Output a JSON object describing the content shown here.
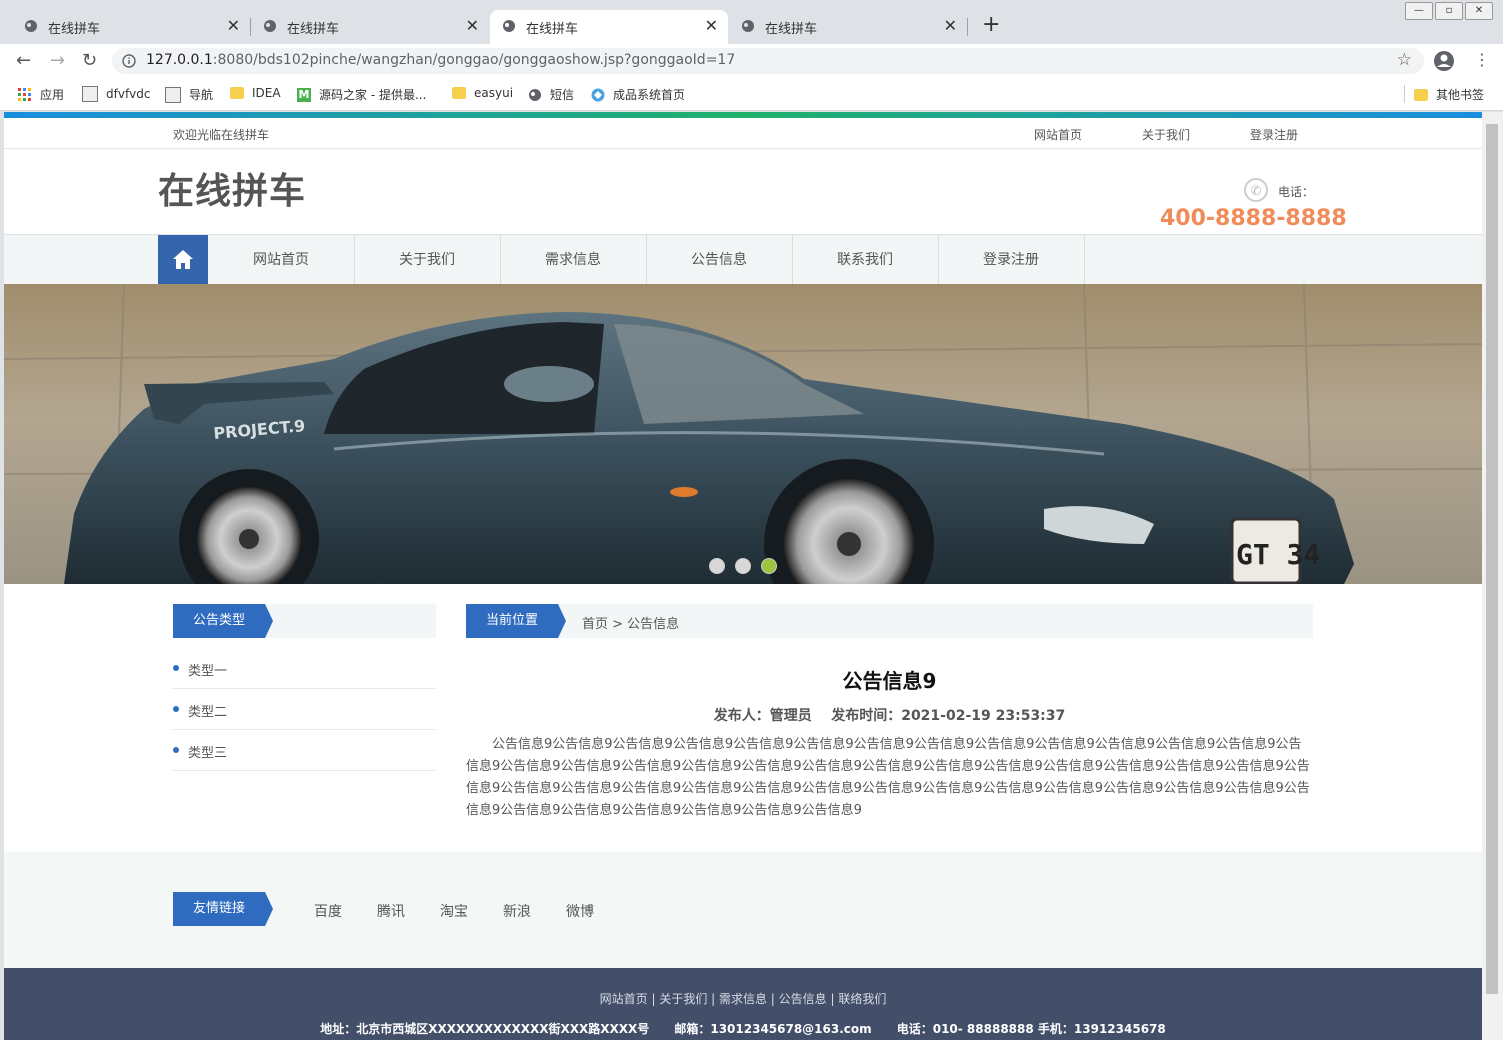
{
  "browser": {
    "tabs": [
      {
        "title": "在线拼车",
        "active": false
      },
      {
        "title": "在线拼车",
        "active": false
      },
      {
        "title": "在线拼车",
        "active": true
      },
      {
        "title": "在线拼车",
        "active": false
      }
    ],
    "url_host": "127.0.0.1",
    "url_rest": ":8080/bds102pinche/wangzhan/gonggao/gonggaoshow.jsp?gonggaoId=17",
    "bookmarks": [
      "应用",
      "dfvfvdc",
      "导航",
      "IDEA",
      "源码之家 - 提供最...",
      "easyui",
      "短信",
      "成品系统首页"
    ],
    "other_bookmarks": "其他书签"
  },
  "site": {
    "welcome": "欢迎光临在线拼车",
    "top_links": [
      "网站首页",
      "关于我们",
      "登录注册"
    ],
    "logo": "在线拼车",
    "phone_label": "电话：",
    "phone_number": "400-8888-8888",
    "nav": [
      "网站首页",
      "关于我们",
      "需求信息",
      "公告信息",
      "联系我们",
      "登录注册"
    ],
    "banner": {
      "dots": 3,
      "active_dot": 2,
      "plate": "GT 34",
      "decal": "PROJECT.9"
    }
  },
  "sidebar": {
    "heading": "公告类型",
    "items": [
      "类型一",
      "类型二",
      "类型三"
    ]
  },
  "breadcrumb": {
    "label": "当前位置",
    "path": "首页 > 公告信息"
  },
  "article": {
    "title": "公告信息9",
    "meta": "发布人：管理员    发布时间：2021-02-19 23:53:37",
    "body": "公告信息9公告信息9公告信息9公告信息9公告信息9公告信息9公告信息9公告信息9公告信息9公告信息9公告信息9公告信息9公告信息9公告信息9公告信息9公告信息9公告信息9公告信息9公告信息9公告信息9公告信息9公告信息9公告信息9公告信息9公告信息9公告信息9公告信息9公告信息9公告信息9公告信息9公告信息9公告信息9公告信息9公告信息9公告信息9公告信息9公告信息9公告信息9公告信息9公告信息9公告信息9公告信息9公告信息9公告信息9公告信息9公告信息9公告信息9公告信息9"
  },
  "friends": {
    "label": "友情链接",
    "links": [
      "百度",
      "腾讯",
      "淘宝",
      "新浪",
      "微博"
    ]
  },
  "footer": {
    "links": "网站首页 | 关于我们 | 需求信息 | 公告信息 | 联络我们",
    "address": "地址：北京市西城区XXXXXXXXXXXXX街XXX路XXXX号      邮箱：13012345678@163.com      电话：010- 88888888 手机：13912345678"
  },
  "colors": {
    "brand_blue": "#2f6cbf",
    "phone_orange": "#f08c5a",
    "footer_bg": "#434e68",
    "dot_active": "#9cc43d"
  }
}
